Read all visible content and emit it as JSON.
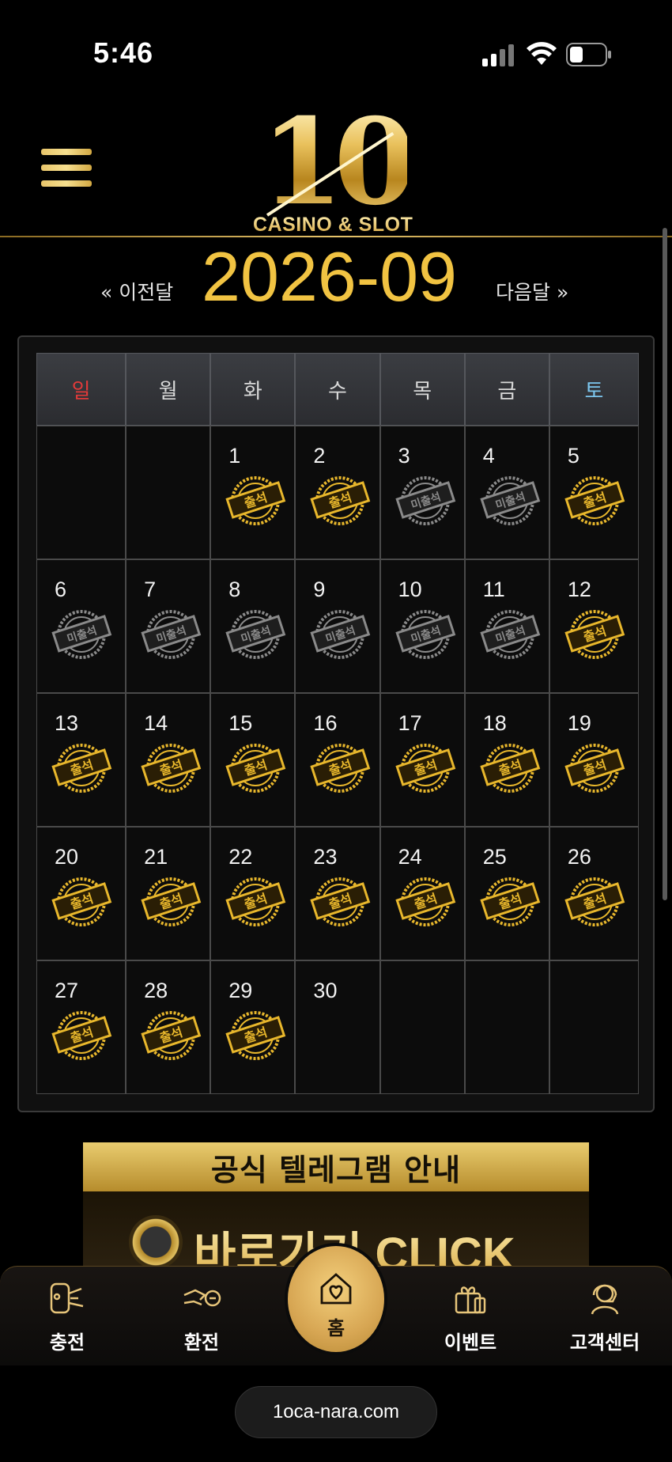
{
  "status_bar": {
    "time": "5:46"
  },
  "header": {
    "logo_number": "10",
    "logo_text": "CASINO & SLOT"
  },
  "month_nav": {
    "prev_label": "« 이전달",
    "title": "2026-09",
    "next_label": "다음달 »"
  },
  "calendar": {
    "weekdays": [
      "일",
      "월",
      "화",
      "수",
      "목",
      "금",
      "토"
    ],
    "weeks": [
      [
        null,
        null,
        {
          "day": "1",
          "stamp": "출석"
        },
        {
          "day": "2",
          "stamp": "출석"
        },
        {
          "day": "3",
          "stamp": "미출석"
        },
        {
          "day": "4",
          "stamp": "미출석"
        },
        {
          "day": "5",
          "stamp": "출석"
        }
      ],
      [
        {
          "day": "6",
          "stamp": "미출석"
        },
        {
          "day": "7",
          "stamp": "미출석"
        },
        {
          "day": "8",
          "stamp": "미출석"
        },
        {
          "day": "9",
          "stamp": "미출석"
        },
        {
          "day": "10",
          "stamp": "미출석"
        },
        {
          "day": "11",
          "stamp": "미출석"
        },
        {
          "day": "12",
          "stamp": "출석"
        }
      ],
      [
        {
          "day": "13",
          "stamp": "출석"
        },
        {
          "day": "14",
          "stamp": "출석"
        },
        {
          "day": "15",
          "stamp": "출석"
        },
        {
          "day": "16",
          "stamp": "출석"
        },
        {
          "day": "17",
          "stamp": "출석"
        },
        {
          "day": "18",
          "stamp": "출석"
        },
        {
          "day": "19",
          "stamp": "출석"
        }
      ],
      [
        {
          "day": "20",
          "stamp": "출석"
        },
        {
          "day": "21",
          "stamp": "출석"
        },
        {
          "day": "22",
          "stamp": "출석"
        },
        {
          "day": "23",
          "stamp": "출석"
        },
        {
          "day": "24",
          "stamp": "출석"
        },
        {
          "day": "25",
          "stamp": "출석"
        },
        {
          "day": "26",
          "stamp": "출석"
        }
      ],
      [
        {
          "day": "27",
          "stamp": "출석"
        },
        {
          "day": "28",
          "stamp": "출석"
        },
        {
          "day": "29",
          "stamp": "출석"
        },
        {
          "day": "30",
          "stamp": null
        },
        null,
        null,
        null
      ]
    ],
    "stamp_colors": {
      "출석": "#e8b72c",
      "미출석": "#8a8a8a"
    }
  },
  "banner": {
    "title": "공식 텔레그램 안내",
    "cta": "바로가기 CLICK",
    "icon": "telegram-icon"
  },
  "bottom_nav": {
    "items": [
      {
        "label": "충전",
        "icon": "charge-icon"
      },
      {
        "label": "환전",
        "icon": "exchange-icon"
      },
      {
        "label": "홈",
        "icon": "home-heart-icon"
      },
      {
        "label": "이벤트",
        "icon": "gift-icon"
      },
      {
        "label": "고객센터",
        "icon": "support-icon"
      }
    ]
  },
  "url": "1oca-nara.com",
  "colors": {
    "accent_gold": "#f1c342",
    "sunday": "#e23a3a",
    "saturday": "#7cc6ee"
  }
}
